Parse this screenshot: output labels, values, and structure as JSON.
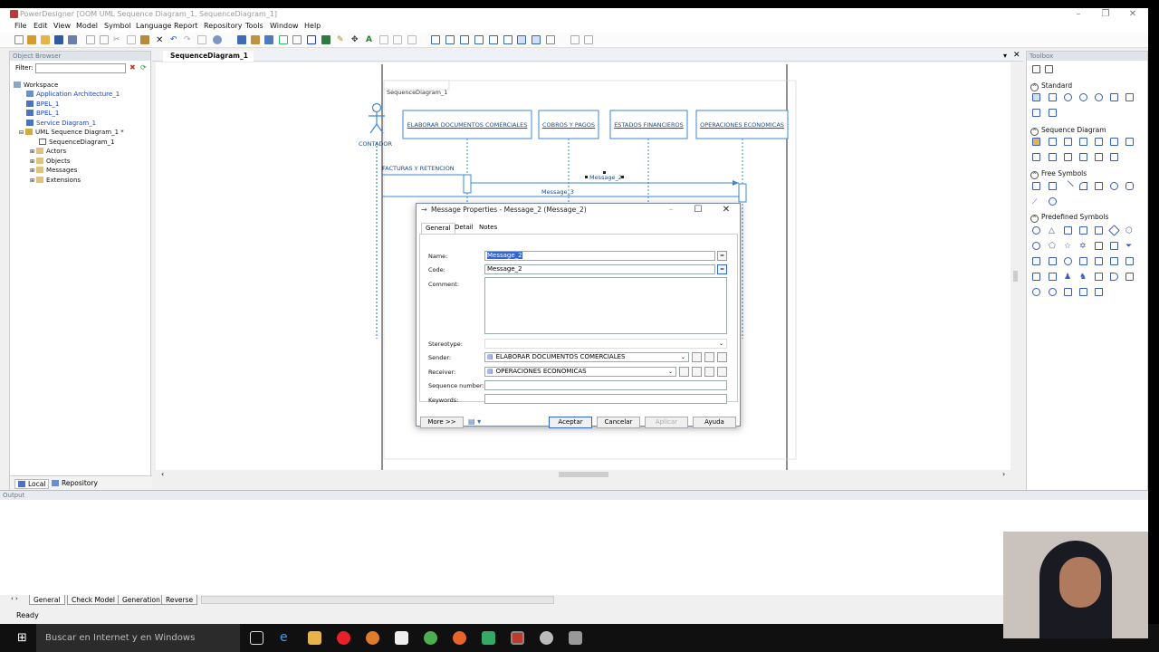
{
  "window": {
    "title": "PowerDesigner [OOM UML Sequence Diagram_1, SequenceDiagram_1]",
    "controls": [
      "–",
      "❐",
      "✕"
    ]
  },
  "menu": [
    "File",
    "Edit",
    "View",
    "Model",
    "Symbol",
    "Language",
    "Report",
    "Repository",
    "Tools",
    "Window",
    "Help"
  ],
  "object_browser": {
    "header": "Object Browser",
    "filter_label": "Filter:",
    "filter_value": "",
    "tree": [
      {
        "label": "Workspace",
        "indent": 0,
        "link": false
      },
      {
        "label": "Application Architecture_1",
        "indent": 1,
        "link": true
      },
      {
        "label": "BPEL_1",
        "indent": 1,
        "link": true
      },
      {
        "label": "BPEL_1",
        "indent": 1,
        "link": true
      },
      {
        "label": "Service Diagram_1",
        "indent": 1,
        "link": true
      },
      {
        "label": "UML Sequence Diagram_1 *",
        "indent": 1,
        "link": false
      },
      {
        "label": "SequenceDiagram_1",
        "indent": 2,
        "link": false
      },
      {
        "label": "Actors",
        "indent": 2,
        "link": false
      },
      {
        "label": "Objects",
        "indent": 2,
        "link": false
      },
      {
        "label": "Messages",
        "indent": 2,
        "link": false
      },
      {
        "label": "Extensions",
        "indent": 2,
        "link": false
      }
    ],
    "bottom_tabs": [
      "Local",
      "Repository"
    ]
  },
  "editor": {
    "tab": "SequenceDiagram_1",
    "diagram_frame_label": "SequenceDiagram_1",
    "actor_label": "CONTADOR",
    "lifelines": [
      "ELABORAR DOCUMENTOS COMERCIALES",
      "COBROS Y PAGOS",
      "ESTADOS FINANCIEROS",
      "OPERACIONES ECONOMICAS"
    ],
    "messages": [
      "FACTURAS Y RETENCION",
      "Message_2",
      "Message_3"
    ]
  },
  "toolbox": {
    "header": "Toolbox",
    "sections": [
      "Standard",
      "Sequence Diagram",
      "Free Symbols",
      "Predefined Symbols"
    ]
  },
  "dialog": {
    "title": "Message Properties - Message_2 (Message_2)",
    "tabs": [
      "General",
      "Detail",
      "Notes"
    ],
    "fields": {
      "name_label": "Name:",
      "name_value": "Message_2",
      "code_label": "Code:",
      "code_value": "Message_2",
      "comment_label": "Comment:",
      "stereotype_label": "Stereotype:",
      "sender_label": "Sender:",
      "sender_value": "ELABORAR DOCUMENTOS COMERCIALES",
      "receiver_label": "Receiver:",
      "receiver_value": "OPERACIONES ECONOMICAS",
      "sequence_label": "Sequence number:",
      "keywords_label": "Keywords:"
    },
    "buttons": {
      "more": "More >>",
      "ok": "Aceptar",
      "cancel": "Cancelar",
      "apply": "Aplicar",
      "help": "Ayuda"
    }
  },
  "output": {
    "header": "Output",
    "tabs": [
      "General",
      "Check Model",
      "Generation",
      "Reverse"
    ]
  },
  "status": "Ready",
  "taskbar": {
    "search_placeholder": "Buscar en Internet y en Windows"
  },
  "colors": {
    "diagram_blue": "#3b87d6",
    "link_blue": "#1b3fd1",
    "taskbar": "#101010"
  }
}
